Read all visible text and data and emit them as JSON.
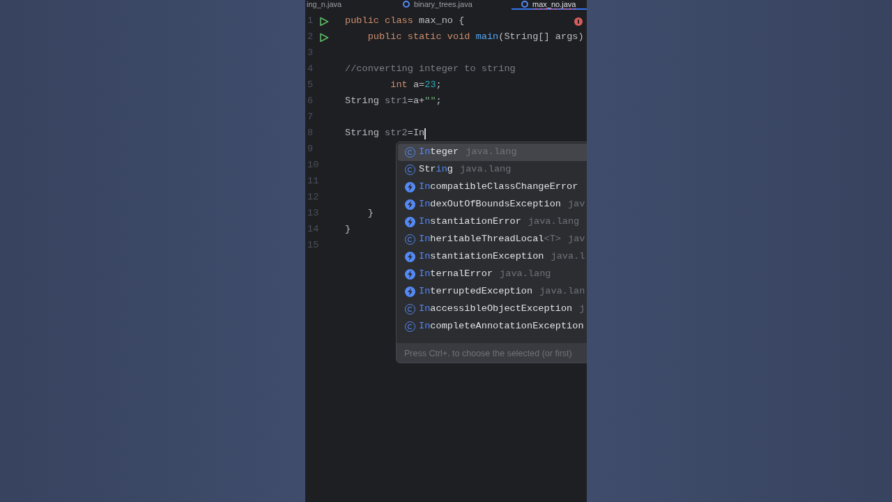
{
  "tabs": [
    {
      "label": "ing_n.java",
      "selected": false
    },
    {
      "label": "binary_trees.java",
      "selected": false
    },
    {
      "label": "max_no.java",
      "selected": true,
      "error": true
    }
  ],
  "editor": {
    "error_marker": true,
    "lines": [
      {
        "number": "1",
        "run": true,
        "tokens": [
          {
            "text": "public class ",
            "kind": "keyword"
          },
          {
            "text": "max_no {",
            "kind": "plain"
          }
        ]
      },
      {
        "number": "2",
        "run": true,
        "tokens": [
          {
            "text": "    public static void ",
            "kind": "keyword"
          },
          {
            "text": "main",
            "kind": "method"
          },
          {
            "text": "(String[] args)",
            "kind": "plain"
          }
        ]
      },
      {
        "number": "3"
      },
      {
        "number": "4",
        "tokens": [
          {
            "text": "//converting integer to string",
            "kind": "comment"
          }
        ]
      },
      {
        "number": "5",
        "tokens": [
          {
            "text": "        int ",
            "kind": "keyword"
          },
          {
            "text": "a=",
            "kind": "plain"
          },
          {
            "text": "23",
            "kind": "number"
          },
          {
            "text": ";",
            "kind": "plain"
          }
        ]
      },
      {
        "number": "6",
        "tokens": [
          {
            "text": "String ",
            "kind": "plain"
          },
          {
            "text": "str1",
            "kind": "unused"
          },
          {
            "text": "=a+",
            "kind": "plain"
          },
          {
            "text": "\"\"",
            "kind": "string"
          },
          {
            "text": ";",
            "kind": "plain"
          }
        ]
      },
      {
        "number": "7"
      },
      {
        "number": "8",
        "caret": true,
        "tokens": [
          {
            "text": "String ",
            "kind": "plain"
          },
          {
            "text": "str2",
            "kind": "unused"
          },
          {
            "text": "=In",
            "kind": "plain"
          }
        ]
      },
      {
        "number": "9"
      },
      {
        "number": "10"
      },
      {
        "number": "11"
      },
      {
        "number": "12"
      },
      {
        "number": "13",
        "tokens": [
          {
            "text": "    }",
            "kind": "plain"
          }
        ]
      },
      {
        "number": "14",
        "tokens": [
          {
            "text": "}",
            "kind": "plain"
          }
        ]
      },
      {
        "number": "15"
      }
    ]
  },
  "completion": {
    "items": [
      {
        "kind": "class",
        "selected": true,
        "name_parts": [
          {
            "text": "In",
            "match": true
          },
          {
            "text": "teger",
            "match": false
          }
        ],
        "package": "java.lang"
      },
      {
        "kind": "class",
        "selected": false,
        "name_parts": [
          {
            "text": "Str",
            "match": false
          },
          {
            "text": "in",
            "match": true
          },
          {
            "text": "g",
            "match": false
          }
        ],
        "package": "java.lang"
      },
      {
        "kind": "exception",
        "selected": false,
        "name_parts": [
          {
            "text": "In",
            "match": true
          },
          {
            "text": "compatibleClassChangeError",
            "match": false
          }
        ]
      },
      {
        "kind": "exception",
        "selected": false,
        "name_parts": [
          {
            "text": "In",
            "match": true
          },
          {
            "text": "dexOutOfBoundsException",
            "match": false
          }
        ],
        "package": "jav"
      },
      {
        "kind": "exception",
        "selected": false,
        "name_parts": [
          {
            "text": "In",
            "match": true
          },
          {
            "text": "stantiationError",
            "match": false
          }
        ],
        "package": "java.lang"
      },
      {
        "kind": "class",
        "selected": false,
        "name_parts": [
          {
            "text": "In",
            "match": true
          },
          {
            "text": "heritableThreadLocal",
            "match": false
          }
        ],
        "type_params": "<T>",
        "package": "jav"
      },
      {
        "kind": "exception",
        "selected": false,
        "name_parts": [
          {
            "text": "In",
            "match": true
          },
          {
            "text": "stantiationException",
            "match": false
          }
        ],
        "package": "java.l"
      },
      {
        "kind": "exception",
        "selected": false,
        "name_parts": [
          {
            "text": "In",
            "match": true
          },
          {
            "text": "ternalError",
            "match": false
          }
        ],
        "package": "java.lang"
      },
      {
        "kind": "exception",
        "selected": false,
        "name_parts": [
          {
            "text": "In",
            "match": true
          },
          {
            "text": "terruptedException",
            "match": false
          }
        ],
        "package": "java.lan"
      },
      {
        "kind": "class",
        "selected": false,
        "name_parts": [
          {
            "text": "In",
            "match": true
          },
          {
            "text": "accessibleObjectException",
            "match": false
          }
        ],
        "package": "j"
      },
      {
        "kind": "class",
        "selected": false,
        "name_parts": [
          {
            "text": "In",
            "match": true
          },
          {
            "text": "completeAnnotationException",
            "match": false
          }
        ]
      }
    ],
    "hint": "Press Ctrl+. to choose the selected (or first)"
  }
}
